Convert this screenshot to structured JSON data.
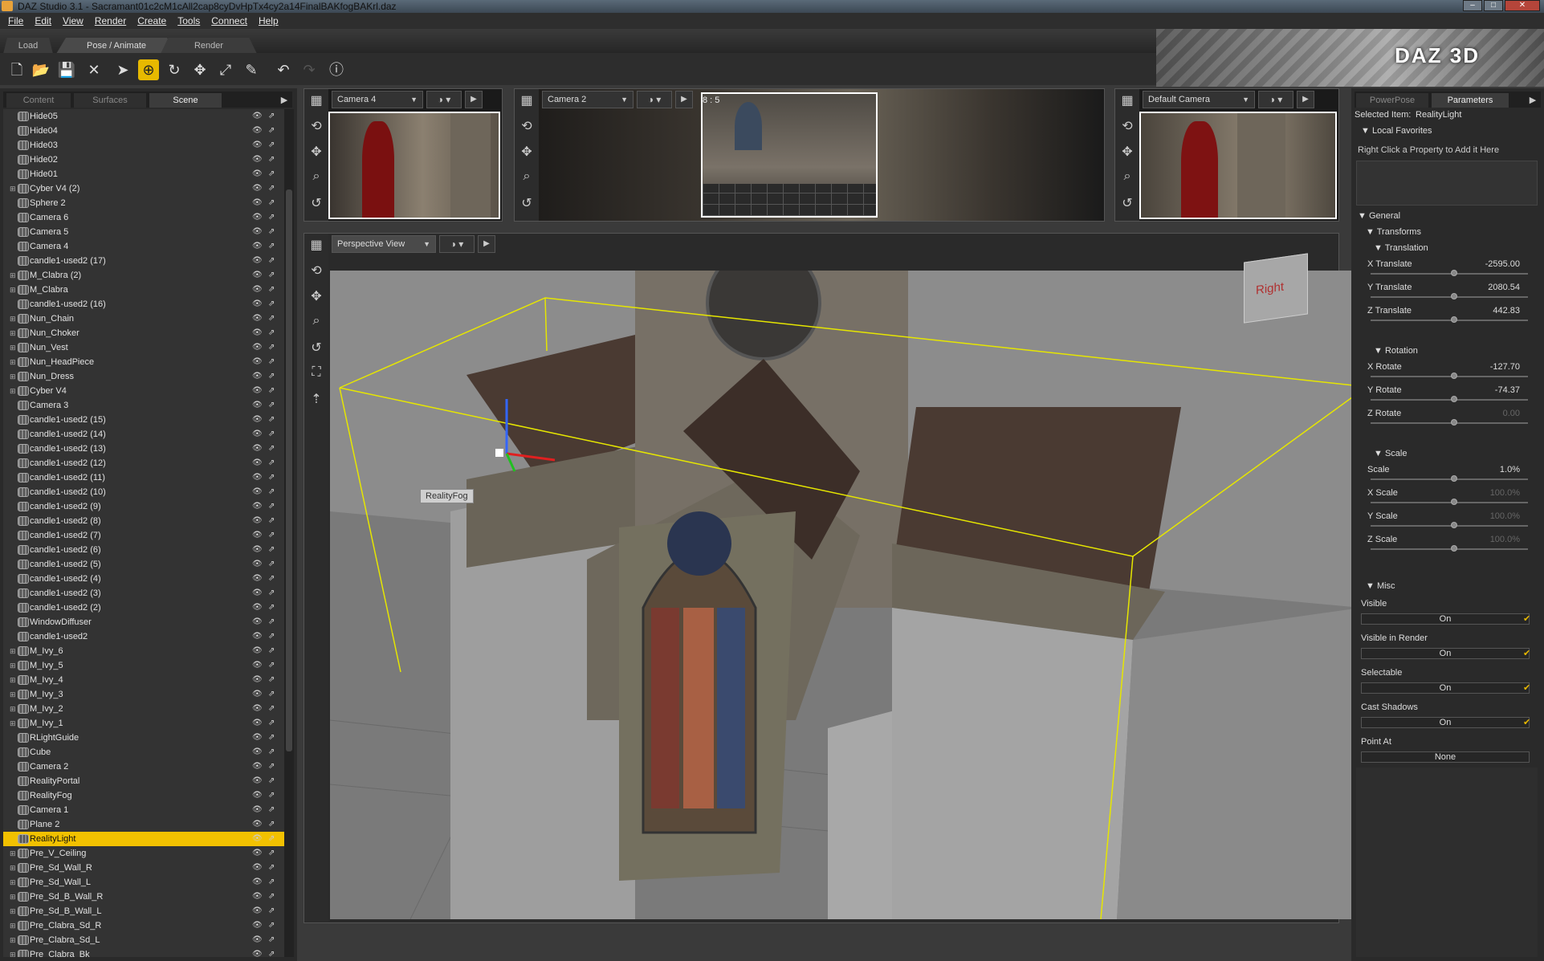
{
  "window": {
    "title": "DAZ Studio 3.1 - Sacramant01c2cM1cAll2cap8cyDvHpTx4cy2a14FinalBAKfogBAKrl.daz"
  },
  "menus": [
    "File",
    "Edit",
    "View",
    "Render",
    "Create",
    "Tools",
    "Connect",
    "Help"
  ],
  "top_tabs": [
    "Load",
    "Pose / Animate",
    "Render"
  ],
  "banner": {
    "logo": "DAZ 3D"
  },
  "left_panel": {
    "tabs": [
      "Content",
      "Surfaces",
      "Scene"
    ],
    "selected_tab": "Scene",
    "nodes": [
      {
        "name": "Hide05",
        "expand": false
      },
      {
        "name": "Hide04",
        "expand": false
      },
      {
        "name": "Hide03",
        "expand": false
      },
      {
        "name": "Hide02",
        "expand": false
      },
      {
        "name": "Hide01",
        "expand": false
      },
      {
        "name": "Cyber V4 (2)",
        "expand": true
      },
      {
        "name": "Sphere 2",
        "expand": false
      },
      {
        "name": "Camera 6",
        "expand": false
      },
      {
        "name": "Camera 5",
        "expand": false
      },
      {
        "name": "Camera 4",
        "expand": false
      },
      {
        "name": "candle1-used2 (17)",
        "expand": false
      },
      {
        "name": "M_Clabra (2)",
        "expand": true
      },
      {
        "name": "M_Clabra",
        "expand": true
      },
      {
        "name": "candle1-used2 (16)",
        "expand": false
      },
      {
        "name": "Nun_Chain",
        "expand": true
      },
      {
        "name": "Nun_Choker",
        "expand": true
      },
      {
        "name": "Nun_Vest",
        "expand": true
      },
      {
        "name": "Nun_HeadPiece",
        "expand": true
      },
      {
        "name": "Nun_Dress",
        "expand": true
      },
      {
        "name": "Cyber V4",
        "expand": true
      },
      {
        "name": "Camera 3",
        "expand": false
      },
      {
        "name": "candle1-used2 (15)",
        "expand": false
      },
      {
        "name": "candle1-used2 (14)",
        "expand": false
      },
      {
        "name": "candle1-used2 (13)",
        "expand": false
      },
      {
        "name": "candle1-used2 (12)",
        "expand": false
      },
      {
        "name": "candle1-used2 (11)",
        "expand": false
      },
      {
        "name": "candle1-used2 (10)",
        "expand": false
      },
      {
        "name": "candle1-used2 (9)",
        "expand": false
      },
      {
        "name": "candle1-used2 (8)",
        "expand": false
      },
      {
        "name": "candle1-used2 (7)",
        "expand": false
      },
      {
        "name": "candle1-used2 (6)",
        "expand": false
      },
      {
        "name": "candle1-used2 (5)",
        "expand": false
      },
      {
        "name": "candle1-used2 (4)",
        "expand": false
      },
      {
        "name": "candle1-used2 (3)",
        "expand": false
      },
      {
        "name": "candle1-used2 (2)",
        "expand": false
      },
      {
        "name": "WindowDiffuser",
        "expand": false
      },
      {
        "name": "candle1-used2",
        "expand": false
      },
      {
        "name": "M_Ivy_6",
        "expand": true
      },
      {
        "name": "M_Ivy_5",
        "expand": true
      },
      {
        "name": "M_Ivy_4",
        "expand": true
      },
      {
        "name": "M_Ivy_3",
        "expand": true
      },
      {
        "name": "M_Ivy_2",
        "expand": true
      },
      {
        "name": "M_Ivy_1",
        "expand": true
      },
      {
        "name": "RLightGuide",
        "expand": false
      },
      {
        "name": "Cube",
        "expand": false
      },
      {
        "name": "Camera 2",
        "expand": false
      },
      {
        "name": "RealityPortal",
        "expand": false
      },
      {
        "name": "RealityFog",
        "expand": false
      },
      {
        "name": "Camera 1",
        "expand": false
      },
      {
        "name": "Plane 2",
        "expand": false
      },
      {
        "name": "RealityLight",
        "expand": false,
        "selected": true
      },
      {
        "name": "Pre_V_Ceiling",
        "expand": true
      },
      {
        "name": "Pre_Sd_Wall_R",
        "expand": true
      },
      {
        "name": "Pre_Sd_Wall_L",
        "expand": true
      },
      {
        "name": "Pre_Sd_B_Wall_R",
        "expand": true
      },
      {
        "name": "Pre_Sd_B_Wall_L",
        "expand": true
      },
      {
        "name": "Pre_Clabra_Sd_R",
        "expand": true
      },
      {
        "name": "Pre_Clabra_Sd_L",
        "expand": true
      },
      {
        "name": "Pre_Clabra_Bk",
        "expand": true
      }
    ]
  },
  "viewports": {
    "v1": {
      "camera": "Camera 4"
    },
    "v2": {
      "camera": "Camera 2",
      "ratio": "8 : 5"
    },
    "v3": {
      "camera": "Default Camera"
    },
    "main": {
      "camera": "Perspective View",
      "label": "RealityFog",
      "cube_face": "Right"
    }
  },
  "right_panel": {
    "tabs": [
      "PowerPose",
      "Parameters"
    ],
    "selected_tab": "Parameters",
    "selected_item_label": "Selected Item:",
    "selected_item": "RealityLight",
    "local_favorites": "Local Favorites",
    "favorites_hint": "Right Click a Property to Add it Here",
    "general": "General",
    "transforms": "Transforms",
    "translation": "Translation",
    "rotation": "Rotation",
    "scale_group": "Scale",
    "misc": "Misc",
    "params": {
      "x_translate": {
        "label": "X Translate",
        "value": "-2595.00"
      },
      "y_translate": {
        "label": "Y Translate",
        "value": "2080.54"
      },
      "z_translate": {
        "label": "Z Translate",
        "value": "442.83"
      },
      "x_rotate": {
        "label": "X Rotate",
        "value": "-127.70"
      },
      "y_rotate": {
        "label": "Y Rotate",
        "value": "-74.37"
      },
      "z_rotate": {
        "label": "Z Rotate",
        "value": "0.00"
      },
      "scale": {
        "label": "Scale",
        "value": "1.0%"
      },
      "x_scale": {
        "label": "X Scale",
        "value": "100.0%"
      },
      "y_scale": {
        "label": "Y Scale",
        "value": "100.0%"
      },
      "z_scale": {
        "label": "Z Scale",
        "value": "100.0%"
      }
    },
    "misc_items": {
      "visible": {
        "label": "Visible",
        "value": "On"
      },
      "visible_render": {
        "label": "Visible in Render",
        "value": "On"
      },
      "selectable": {
        "label": "Selectable",
        "value": "On"
      },
      "cast_shadows": {
        "label": "Cast Shadows",
        "value": "On"
      },
      "point_at": {
        "label": "Point At",
        "value": "None"
      }
    }
  },
  "colors": {
    "accent": "#f2c100",
    "panel": "#2a2a2a",
    "bounding_box": "#e6e600"
  }
}
